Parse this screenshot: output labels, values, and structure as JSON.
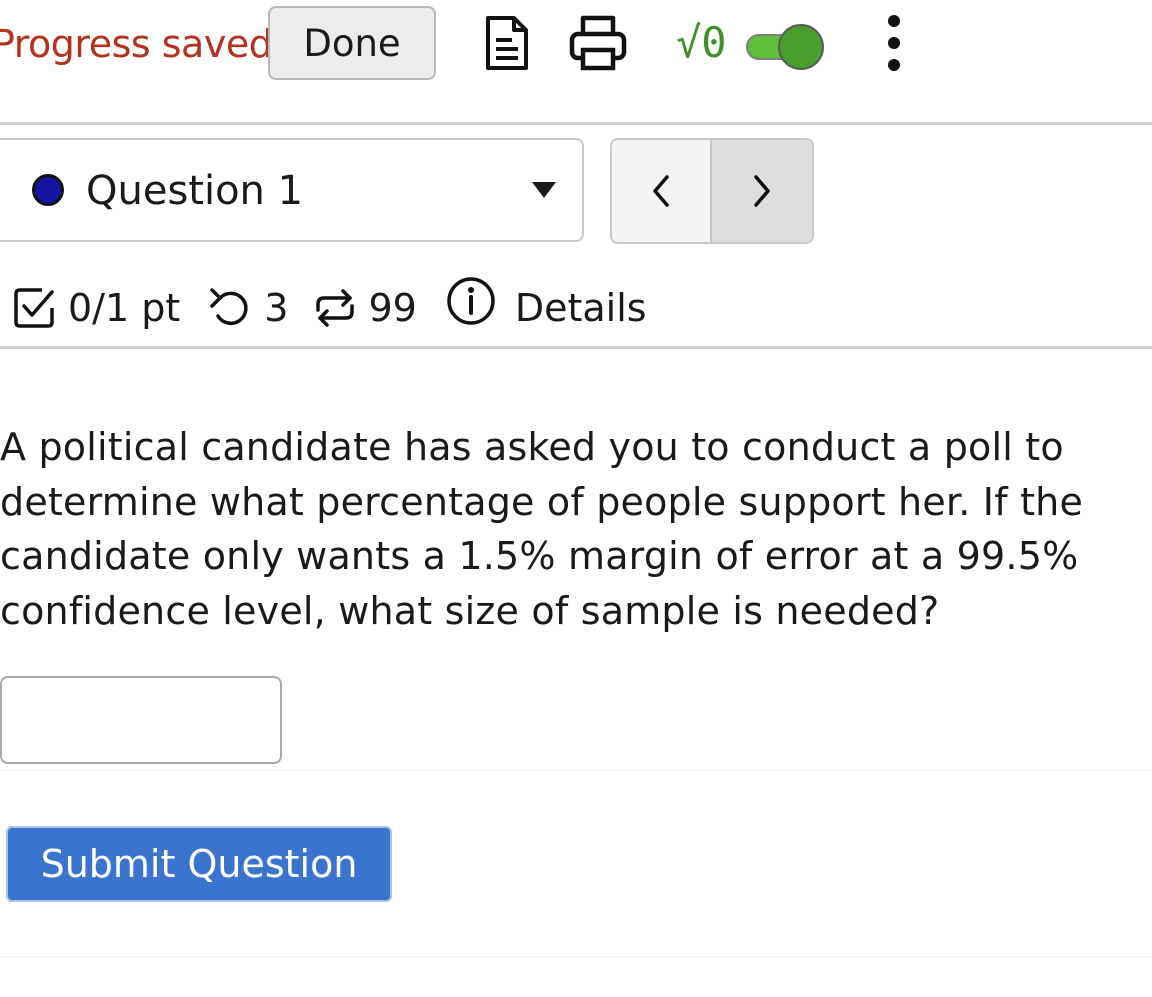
{
  "toolbar": {
    "status_text": "Progress saved",
    "done_label": "Done",
    "sqrt_label": "√0",
    "icons": [
      "document-icon",
      "print-icon",
      "math-toggle-icon",
      "more-vertical-icon"
    ]
  },
  "question_selector": {
    "selected": "Question 1",
    "status_color": "#1414a0"
  },
  "meta": {
    "score": "0/1 pt",
    "retries": "3",
    "attempts": "99",
    "details_label": "Details"
  },
  "question": {
    "text": "A political candidate has asked you to conduct a poll to determine what percentage of people support her. If the candidate only wants a 1.5% margin of error at a 99.5% confidence level, what size of sample is needed?",
    "answer_value": ""
  },
  "submit_label": "Submit Question",
  "colors": {
    "status": "#b5321e",
    "toggle_on": "#4a9e2c",
    "submit": "#3b74cf"
  }
}
